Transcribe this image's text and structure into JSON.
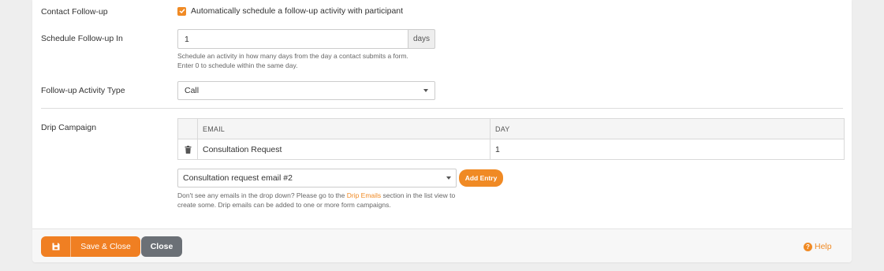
{
  "form": {
    "contact_followup": {
      "label": "Contact Follow-up",
      "checkbox_label": "Automatically schedule a follow-up activity with participant",
      "checked": true
    },
    "schedule_followup": {
      "label": "Schedule Follow-up In",
      "value": "1",
      "unit": "days",
      "hint_line1": "Schedule an activity in how many days from the day a contact submits a form.",
      "hint_line2": "Enter 0 to schedule within the same day."
    },
    "activity_type": {
      "label": "Follow-up Activity Type",
      "selected": "Call"
    },
    "drip_campaign": {
      "label": "Drip Campaign",
      "columns": [
        "EMAIL",
        "DAY"
      ],
      "rows": [
        {
          "email": "Consultation Request",
          "day": "1"
        }
      ],
      "email_select": "Consultation request email #2",
      "add_entry_label": "Add Entry",
      "hint_pre": "Don't see any emails in the drop down? Please go to the ",
      "hint_link": "Drip Emails",
      "hint_post": " section in the list view to",
      "hint_line2": "create some. Drip emails can be added to one or more form campaigns."
    }
  },
  "footer": {
    "save_close_label": "Save & Close",
    "close_label": "Close",
    "help_label": "Help"
  },
  "colors": {
    "accent": "#f08a24",
    "close_button": "#6b7076"
  },
  "icons": {
    "check": "check-icon",
    "caret": "chevron-down-icon",
    "trash": "trash-icon",
    "save": "save-icon",
    "help": "help-icon"
  }
}
